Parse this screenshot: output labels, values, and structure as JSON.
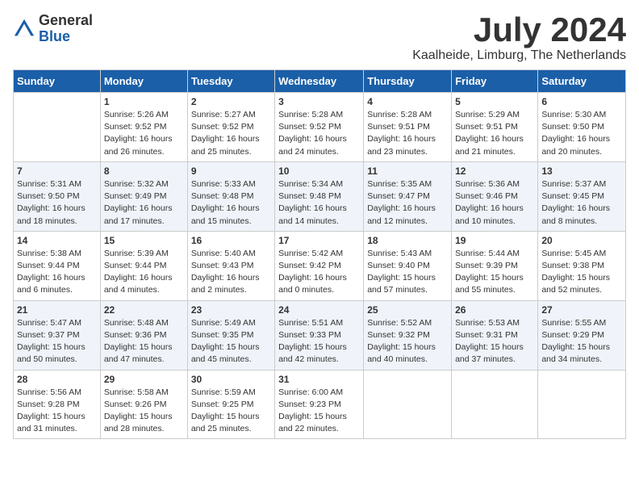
{
  "logo": {
    "general": "General",
    "blue": "Blue"
  },
  "title": "July 2024",
  "location": "Kaalheide, Limburg, The Netherlands",
  "days_of_week": [
    "Sunday",
    "Monday",
    "Tuesday",
    "Wednesday",
    "Thursday",
    "Friday",
    "Saturday"
  ],
  "weeks": [
    [
      {
        "day": "",
        "info": ""
      },
      {
        "day": "1",
        "info": "Sunrise: 5:26 AM\nSunset: 9:52 PM\nDaylight: 16 hours\nand 26 minutes."
      },
      {
        "day": "2",
        "info": "Sunrise: 5:27 AM\nSunset: 9:52 PM\nDaylight: 16 hours\nand 25 minutes."
      },
      {
        "day": "3",
        "info": "Sunrise: 5:28 AM\nSunset: 9:52 PM\nDaylight: 16 hours\nand 24 minutes."
      },
      {
        "day": "4",
        "info": "Sunrise: 5:28 AM\nSunset: 9:51 PM\nDaylight: 16 hours\nand 23 minutes."
      },
      {
        "day": "5",
        "info": "Sunrise: 5:29 AM\nSunset: 9:51 PM\nDaylight: 16 hours\nand 21 minutes."
      },
      {
        "day": "6",
        "info": "Sunrise: 5:30 AM\nSunset: 9:50 PM\nDaylight: 16 hours\nand 20 minutes."
      }
    ],
    [
      {
        "day": "7",
        "info": "Sunrise: 5:31 AM\nSunset: 9:50 PM\nDaylight: 16 hours\nand 18 minutes."
      },
      {
        "day": "8",
        "info": "Sunrise: 5:32 AM\nSunset: 9:49 PM\nDaylight: 16 hours\nand 17 minutes."
      },
      {
        "day": "9",
        "info": "Sunrise: 5:33 AM\nSunset: 9:48 PM\nDaylight: 16 hours\nand 15 minutes."
      },
      {
        "day": "10",
        "info": "Sunrise: 5:34 AM\nSunset: 9:48 PM\nDaylight: 16 hours\nand 14 minutes."
      },
      {
        "day": "11",
        "info": "Sunrise: 5:35 AM\nSunset: 9:47 PM\nDaylight: 16 hours\nand 12 minutes."
      },
      {
        "day": "12",
        "info": "Sunrise: 5:36 AM\nSunset: 9:46 PM\nDaylight: 16 hours\nand 10 minutes."
      },
      {
        "day": "13",
        "info": "Sunrise: 5:37 AM\nSunset: 9:45 PM\nDaylight: 16 hours\nand 8 minutes."
      }
    ],
    [
      {
        "day": "14",
        "info": "Sunrise: 5:38 AM\nSunset: 9:44 PM\nDaylight: 16 hours\nand 6 minutes."
      },
      {
        "day": "15",
        "info": "Sunrise: 5:39 AM\nSunset: 9:44 PM\nDaylight: 16 hours\nand 4 minutes."
      },
      {
        "day": "16",
        "info": "Sunrise: 5:40 AM\nSunset: 9:43 PM\nDaylight: 16 hours\nand 2 minutes."
      },
      {
        "day": "17",
        "info": "Sunrise: 5:42 AM\nSunset: 9:42 PM\nDaylight: 16 hours\nand 0 minutes."
      },
      {
        "day": "18",
        "info": "Sunrise: 5:43 AM\nSunset: 9:40 PM\nDaylight: 15 hours\nand 57 minutes."
      },
      {
        "day": "19",
        "info": "Sunrise: 5:44 AM\nSunset: 9:39 PM\nDaylight: 15 hours\nand 55 minutes."
      },
      {
        "day": "20",
        "info": "Sunrise: 5:45 AM\nSunset: 9:38 PM\nDaylight: 15 hours\nand 52 minutes."
      }
    ],
    [
      {
        "day": "21",
        "info": "Sunrise: 5:47 AM\nSunset: 9:37 PM\nDaylight: 15 hours\nand 50 minutes."
      },
      {
        "day": "22",
        "info": "Sunrise: 5:48 AM\nSunset: 9:36 PM\nDaylight: 15 hours\nand 47 minutes."
      },
      {
        "day": "23",
        "info": "Sunrise: 5:49 AM\nSunset: 9:35 PM\nDaylight: 15 hours\nand 45 minutes."
      },
      {
        "day": "24",
        "info": "Sunrise: 5:51 AM\nSunset: 9:33 PM\nDaylight: 15 hours\nand 42 minutes."
      },
      {
        "day": "25",
        "info": "Sunrise: 5:52 AM\nSunset: 9:32 PM\nDaylight: 15 hours\nand 40 minutes."
      },
      {
        "day": "26",
        "info": "Sunrise: 5:53 AM\nSunset: 9:31 PM\nDaylight: 15 hours\nand 37 minutes."
      },
      {
        "day": "27",
        "info": "Sunrise: 5:55 AM\nSunset: 9:29 PM\nDaylight: 15 hours\nand 34 minutes."
      }
    ],
    [
      {
        "day": "28",
        "info": "Sunrise: 5:56 AM\nSunset: 9:28 PM\nDaylight: 15 hours\nand 31 minutes."
      },
      {
        "day": "29",
        "info": "Sunrise: 5:58 AM\nSunset: 9:26 PM\nDaylight: 15 hours\nand 28 minutes."
      },
      {
        "day": "30",
        "info": "Sunrise: 5:59 AM\nSunset: 9:25 PM\nDaylight: 15 hours\nand 25 minutes."
      },
      {
        "day": "31",
        "info": "Sunrise: 6:00 AM\nSunset: 9:23 PM\nDaylight: 15 hours\nand 22 minutes."
      },
      {
        "day": "",
        "info": ""
      },
      {
        "day": "",
        "info": ""
      },
      {
        "day": "",
        "info": ""
      }
    ]
  ]
}
